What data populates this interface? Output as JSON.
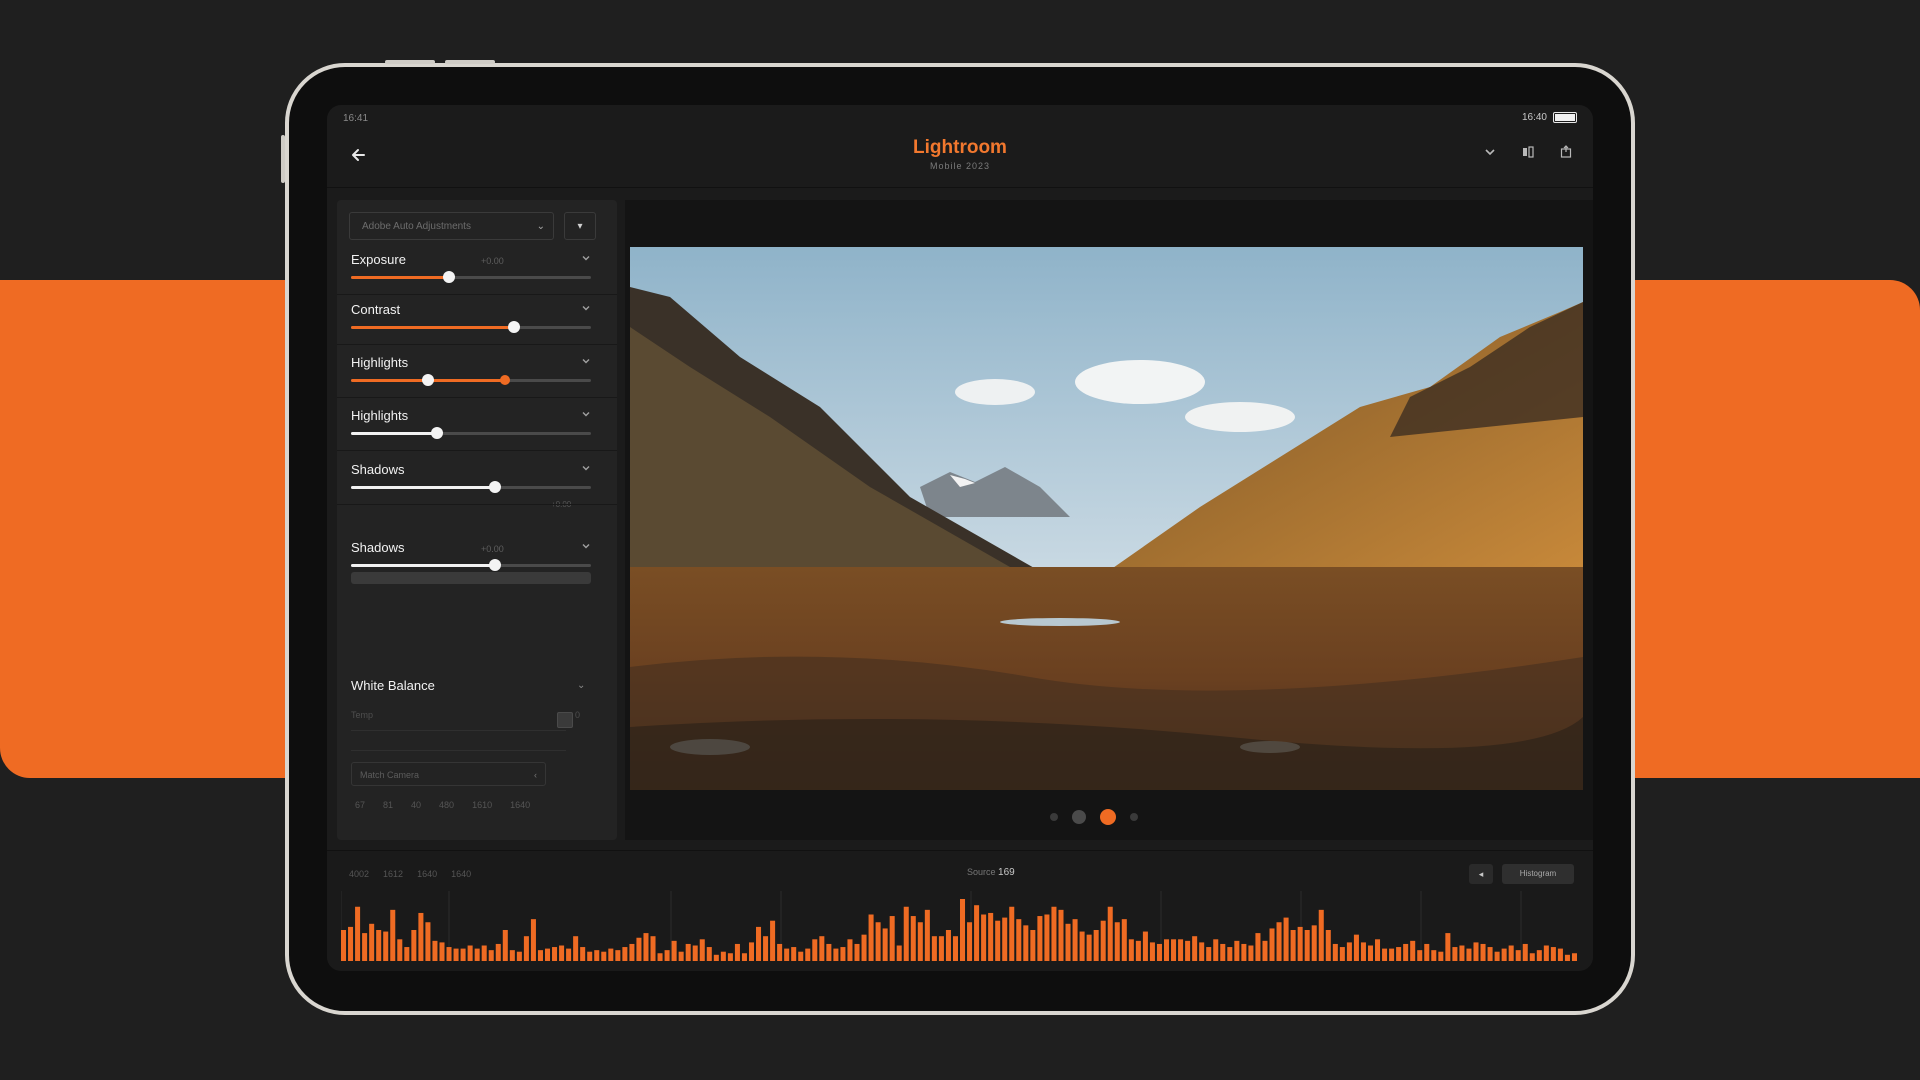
{
  "colors": {
    "accent": "#ef6b23",
    "background": "#1f1f1f",
    "panel": "#232323"
  },
  "status": {
    "time": "16:41",
    "right": "16:40"
  },
  "app": {
    "title": "Lightroom",
    "subtitle": "Mobile 2023"
  },
  "icons": {
    "back": "back-arrow-icon",
    "dropdown": "chevron-down-icon",
    "compare": "compare-icon",
    "share": "share-icon"
  },
  "panel": {
    "preset_label": "Adobe Auto Adjustments",
    "preset_button": "▾",
    "sliders": [
      {
        "label": "Exposure",
        "value": "+0.00",
        "level": 0.41,
        "color": "orange"
      },
      {
        "label": "Contrast",
        "value": "",
        "level": 0.68,
        "color": "orange"
      },
      {
        "label": "Highlights",
        "value": "",
        "level": 0.64,
        "color": "orange",
        "second_knob": 0.32
      },
      {
        "label": "Highlights",
        "value": "",
        "level": 0.36,
        "color": "white"
      },
      {
        "label": "Shadows",
        "value": "",
        "level": 0.6,
        "color": "white",
        "note": "+0.00"
      },
      {
        "label": "Shadows",
        "value": "+0.00",
        "level": 0.6,
        "color": "white"
      }
    ],
    "white_balance": {
      "label": "White Balance",
      "temp_label": "Temp",
      "tint_value": "0",
      "camera_select": "Match Camera"
    },
    "bottom_numbers": [
      "67",
      "81",
      "40",
      "480",
      "1610",
      "1640"
    ]
  },
  "viewer": {
    "page_dots": 4,
    "active_dot": 2
  },
  "bottom": {
    "labels": [
      "4002",
      "1612",
      "1640",
      "1640"
    ],
    "center_label": "Source",
    "center_value": "169",
    "button1": "◂",
    "button2": "Histogram"
  },
  "histogram": [
    20,
    22,
    35,
    18,
    24,
    20,
    19,
    33,
    14,
    9,
    20,
    31,
    25,
    13,
    12,
    9,
    8,
    8,
    10,
    8,
    10,
    7,
    11,
    20,
    7,
    6,
    16,
    27,
    7,
    8,
    9,
    10,
    8,
    16,
    9,
    6,
    7,
    6,
    8,
    7,
    9,
    11,
    15,
    18,
    16,
    5,
    7,
    13,
    6,
    11,
    10,
    14,
    9,
    4,
    6,
    5,
    11,
    5,
    12,
    22,
    16,
    26,
    11,
    8,
    9,
    6,
    8,
    14,
    16,
    11,
    8,
    9,
    14,
    11,
    17,
    30,
    25,
    21,
    29,
    10,
    35,
    29,
    25,
    33,
    16,
    16,
    20,
    16,
    40,
    25,
    36,
    30,
    31,
    26,
    28,
    35,
    27,
    23,
    20,
    29,
    30,
    35,
    33,
    24,
    27,
    19,
    17,
    20,
    26,
    35,
    25,
    27,
    14,
    13,
    19,
    12,
    11,
    14,
    14,
    14,
    13,
    16,
    12,
    9,
    14,
    11,
    9,
    13,
    11,
    10,
    18,
    13,
    21,
    25,
    28,
    20,
    22,
    20,
    23,
    33,
    20,
    11,
    9,
    12,
    17,
    12,
    10,
    14,
    8,
    8,
    9,
    11,
    13,
    7,
    11,
    7,
    6,
    18,
    9,
    10,
    8,
    12,
    11,
    9,
    6,
    8,
    10,
    7,
    11,
    5,
    7,
    10,
    9,
    8,
    4,
    5
  ]
}
